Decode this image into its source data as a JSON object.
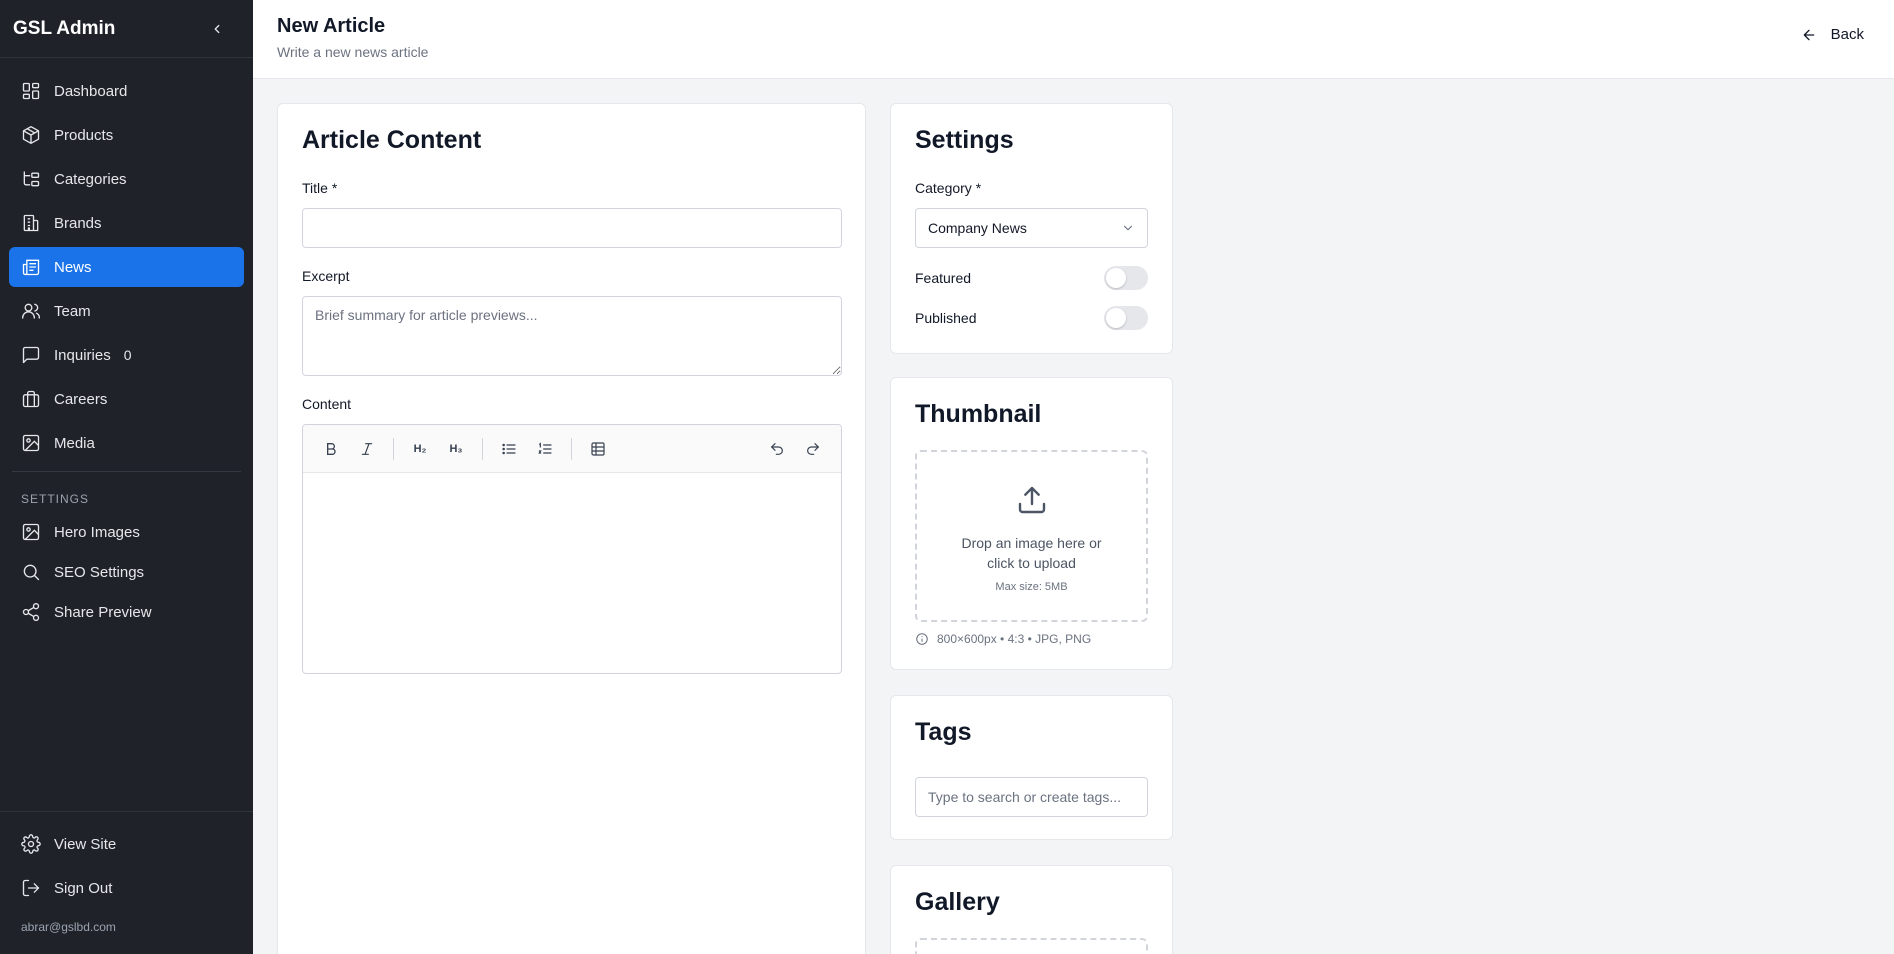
{
  "sidebar": {
    "brand": "GSL Admin",
    "items": [
      {
        "label": "Dashboard"
      },
      {
        "label": "Products"
      },
      {
        "label": "Categories"
      },
      {
        "label": "Brands"
      },
      {
        "label": "News"
      },
      {
        "label": "Team"
      },
      {
        "label": "Inquiries",
        "badge": "0"
      },
      {
        "label": "Careers"
      },
      {
        "label": "Media"
      }
    ],
    "settings_section": "SETTINGS",
    "settings_items": [
      {
        "label": "Hero Images"
      },
      {
        "label": "SEO Settings"
      },
      {
        "label": "Share Preview"
      }
    ],
    "bottom_items": [
      {
        "label": "View Site"
      },
      {
        "label": "Sign Out"
      }
    ],
    "email": "abrar@gslbd.com",
    "active_color": "#1a73e8"
  },
  "header": {
    "title": "New Article",
    "subtitle": "Write a new news article",
    "back_label": "Back"
  },
  "content_card": {
    "title": "Article Content",
    "title_label": "Title *",
    "title_value": "",
    "excerpt_label": "Excerpt",
    "excerpt_placeholder": "Brief summary for article previews...",
    "content_label": "Content",
    "toolbar": {
      "h2": "H₂",
      "h3": "H₃"
    }
  },
  "settings_card": {
    "title": "Settings",
    "category_label": "Category *",
    "category_value": "Company News",
    "featured_label": "Featured",
    "featured_on": false,
    "published_label": "Published",
    "published_on": false
  },
  "thumbnail_card": {
    "title": "Thumbnail",
    "drop_text": "Drop an image here or click to upload",
    "max_size": "Max size: 5MB",
    "info": "800×600px • 4:3 • JPG, PNG"
  },
  "tags_card": {
    "title": "Tags",
    "placeholder": "Type to search or create tags..."
  },
  "gallery_card": {
    "title": "Gallery"
  }
}
